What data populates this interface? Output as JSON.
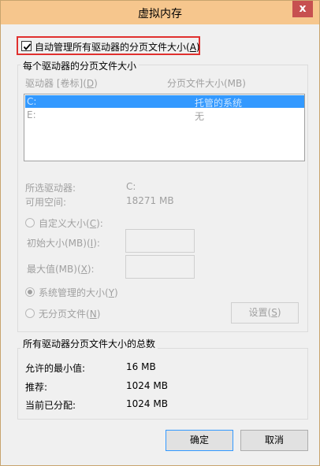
{
  "window": {
    "title": "虚拟内存",
    "close_glyph": "x"
  },
  "auto_manage": {
    "label": "自动管理所有驱动器的分页文件大小",
    "accel": "A",
    "checked": true
  },
  "per_drive": {
    "group_title": "每个驱动器的分页文件大小",
    "col_drive": "驱动器 [卷标]",
    "col_drive_accel": "D",
    "col_size": "分页文件大小(MB)",
    "rows": [
      {
        "drive": "C:",
        "size": "托管的系统",
        "selected": true
      },
      {
        "drive": "E:",
        "size": "无",
        "selected": false
      }
    ],
    "selected_drive_label": "所选驱动器:",
    "selected_drive_value": "C:",
    "free_space_label": "可用空间:",
    "free_space_value": "18271 MB",
    "custom_size_label": "自定义大小",
    "custom_size_accel": "C",
    "initial_size_label": "初始大小(MB)",
    "initial_size_accel": "I",
    "max_size_label": "最大值(MB)",
    "max_size_accel": "X",
    "system_managed_label": "系统管理的大小",
    "system_managed_accel": "Y",
    "no_paging_label": "无分页文件",
    "no_paging_accel": "N",
    "set_button_label": "设置",
    "set_button_accel": "S"
  },
  "totals": {
    "group_title": "所有驱动器分页文件大小的总数",
    "min_label": "允许的最小值:",
    "min_value": "16 MB",
    "rec_label": "推荐:",
    "rec_value": "1024 MB",
    "cur_label": "当前已分配:",
    "cur_value": "1024 MB"
  },
  "footer": {
    "ok_label": "确定",
    "cancel_label": "取消"
  }
}
